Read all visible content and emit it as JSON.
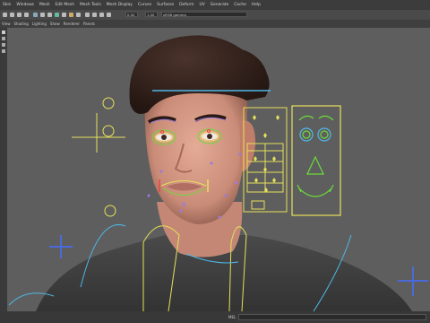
{
  "menubar": {
    "items": [
      "Skin",
      "Windows",
      "Mesh",
      "Edit Mesh",
      "Mesh Tools",
      "Mesh Display",
      "Curves",
      "Surfaces",
      "Deform",
      "UV",
      "Generate",
      "Cache",
      "Help"
    ]
  },
  "toolbar": {
    "field_a": "0.00",
    "field_b": "1.00",
    "color_profile": "sRGB gamma"
  },
  "panel_menu": {
    "items": [
      "View",
      "Shading",
      "Lighting",
      "Show",
      "Renderer",
      "Panels"
    ]
  },
  "status": {
    "mel_label": "MEL"
  },
  "colors": {
    "menubar_bg": "#3c3c3c",
    "viewport_bg": "#5e5e5e",
    "rig_yellow": "#e6e05a",
    "rig_green": "#6ddc3a",
    "rig_cyan": "#4fb8e8",
    "rig_blue": "#4a6ad8",
    "rig_purple": "#9a78e0",
    "skin": "#d8a08c",
    "hair": "#3a2620"
  },
  "icons": [
    "select-tool-icon",
    "move-tool-icon",
    "rotate-tool-icon",
    "scale-tool-icon",
    "camera-icon",
    "grid-icon",
    "wireframe-icon",
    "shaded-icon",
    "textured-icon",
    "lights-icon",
    "shadows-icon",
    "isolate-icon",
    "xray-icon"
  ]
}
